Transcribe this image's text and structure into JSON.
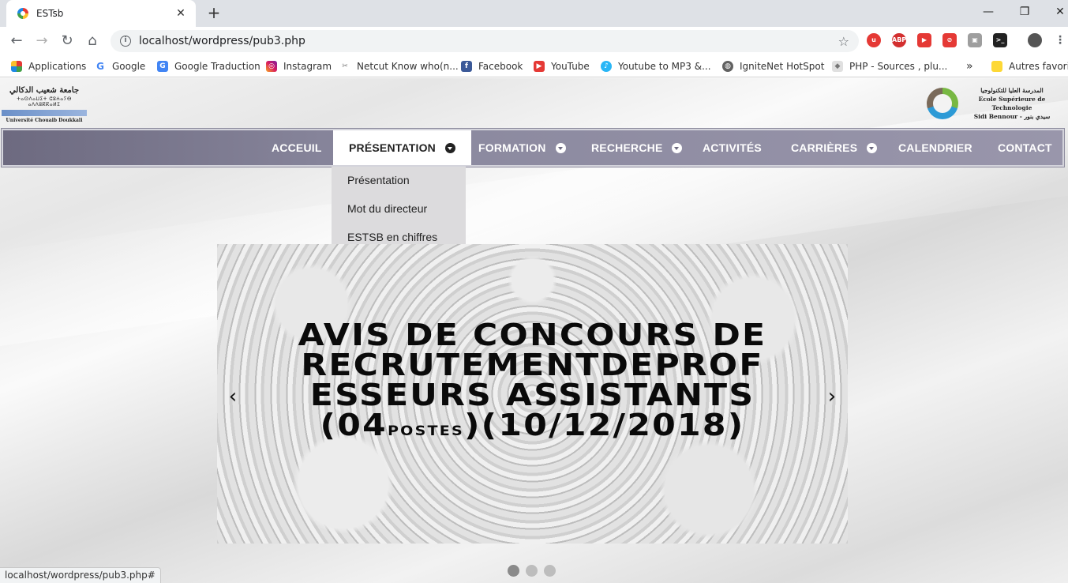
{
  "browser": {
    "tab_title": "ESTsb",
    "url": "localhost/wordpress/pub3.php",
    "status_url": "localhost/wordpress/pub3.php#",
    "bookmarks": [
      {
        "label": "Applications"
      },
      {
        "label": "Google"
      },
      {
        "label": "Google Traduction"
      },
      {
        "label": "Instagram"
      },
      {
        "label": "Netcut Know who(n..."
      },
      {
        "label": "Facebook"
      },
      {
        "label": "YouTube"
      },
      {
        "label": "Youtube to MP3 &..."
      },
      {
        "label": "IgniteNet HotSpot"
      },
      {
        "label": "PHP - Sources , plu..."
      }
    ],
    "other_bookmarks": "Autres favoris",
    "more_bookmarks": "»"
  },
  "header": {
    "left_logo": {
      "arabic": "جامعة شعيب الدكالي",
      "tifinagh": "ⵜⴰⵙⴷⴰⵡⵉⵜ ⵛⵓⵄⴰⵢⴱ ⴰⴷⴷⵓⴽⴽⴰⵍⵉ",
      "french": "Université Chouaib Doukkali"
    },
    "right_logo": {
      "arabic": "المدرسة العليا للتكنولوجيا",
      "line1": "Ecole Supérieure de Technologie",
      "line2": "Sidi Bennour - سيدي بنور"
    }
  },
  "nav": {
    "items": [
      {
        "label": "ACCEUIL"
      },
      {
        "label": "PRÉSENTATION"
      },
      {
        "label": "FORMATION"
      },
      {
        "label": "RECHERCHE"
      },
      {
        "label": "ACTIVITÉS"
      },
      {
        "label": "CARRIÈRES"
      },
      {
        "label": "CALENDRIER"
      },
      {
        "label": "CONTACT"
      }
    ],
    "dropdown": [
      "Présentation",
      "Mot du directeur",
      "ESTSB en chiffres"
    ]
  },
  "slider": {
    "lines": [
      "AVIS DE CONCOURS DE",
      "RECRUTEMENTDEPROF",
      "ESSEURS ASSISTANTS"
    ],
    "line4_a": "(04",
    "line4_small": "postes",
    "line4_b": ")(10/12/2018)",
    "prev": "‹",
    "next": "›"
  },
  "colors": {
    "nav_bg": "#8a889e",
    "dropdown_bg": "#dcdbdd"
  }
}
